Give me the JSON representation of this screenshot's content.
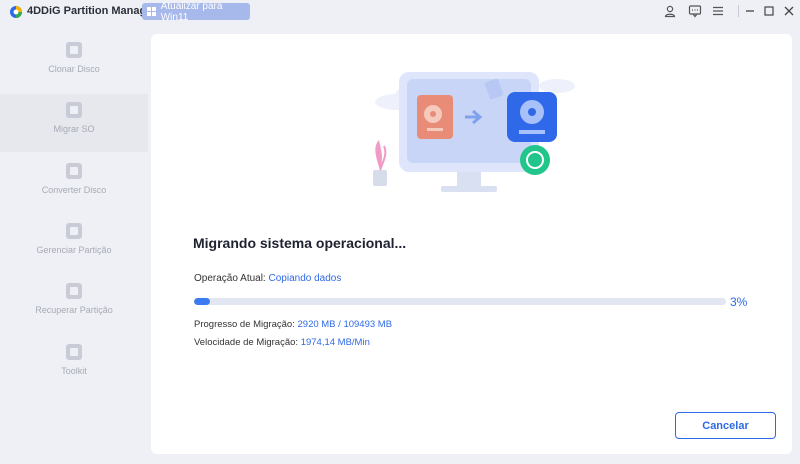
{
  "app": {
    "title": "4DDiG Partition Manager",
    "upgrade_label": "Atualizar para Win11"
  },
  "window_controls": {
    "icons": [
      "user-icon",
      "feedback-icon",
      "menu-icon",
      "minimize-icon",
      "maximize-icon",
      "close-icon"
    ]
  },
  "sidebar": {
    "items": [
      {
        "label": "Clonar Disco",
        "icon": "clone-disk-icon",
        "active": false
      },
      {
        "label": "Migrar SO",
        "icon": "migrate-os-icon",
        "active": true
      },
      {
        "label": "Converter Disco",
        "icon": "convert-disk-icon",
        "active": false
      },
      {
        "label": "Gerenciar Partição",
        "icon": "manage-partition-icon",
        "active": false
      },
      {
        "label": "Recuperar Partição",
        "icon": "recover-partition-icon",
        "active": false
      },
      {
        "label": "Toolkit",
        "icon": "toolkit-icon",
        "active": false
      }
    ]
  },
  "main": {
    "heading": "Migrando sistema operacional...",
    "operation_label": "Operação Atual:",
    "operation_value": "Copiando dados",
    "progress_percent": 3,
    "progress_text": "3%",
    "migration_label": "Progresso de Migração:",
    "migration_done": "2920 MB",
    "migration_sep": " / ",
    "migration_total": "109493 MB",
    "speed_label": "Velocidade de Migração:",
    "speed_value": "1974,14 MB/Min",
    "cancel_label": "Cancelar"
  },
  "colors": {
    "accent": "#2e6ae6",
    "background": "#eef0f5",
    "panel": "#ffffff"
  }
}
